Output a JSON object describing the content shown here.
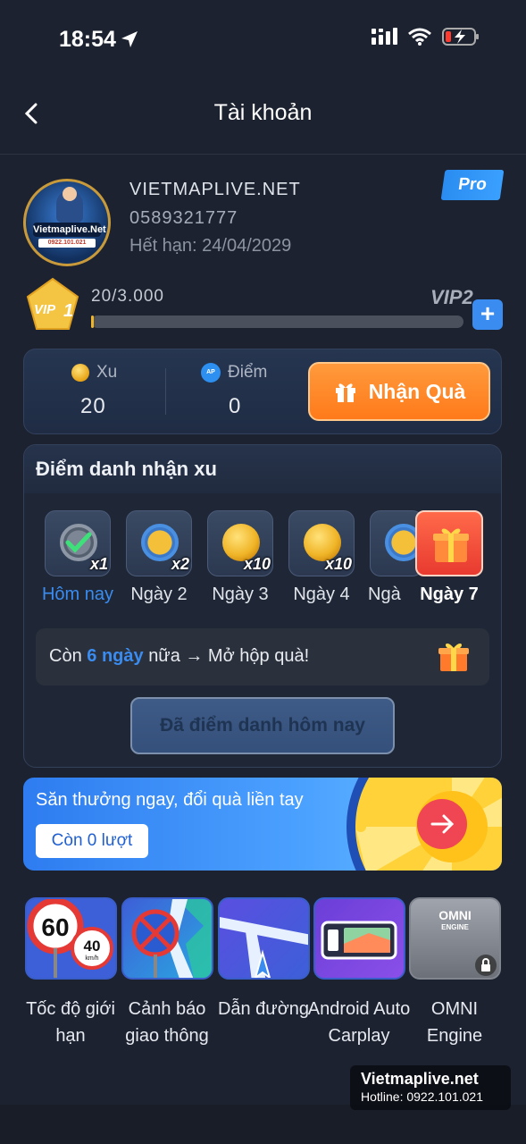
{
  "status_bar": {
    "time": "18:54"
  },
  "nav": {
    "title": "Tài khoản"
  },
  "profile": {
    "name": "VIETMAPLIVE.NET",
    "phone": "0589321777",
    "expiry": "Hết hạn: 24/04/2029",
    "badge": "Pro",
    "avatar_text": "Vietmaplive.Net",
    "avatar_subtext": "0922.101.021"
  },
  "vip": {
    "current_level_text": "VIP",
    "current_level_number": "1",
    "progress_text": "20/3.000",
    "progress_fraction": 0.0067,
    "next_level": "VIP2",
    "plus_label": "+"
  },
  "points": {
    "xu_label": "Xu",
    "xu_value": "20",
    "diem_label": "Điểm",
    "diem_value": "0",
    "ap_icon": "AP",
    "gift_button": "Nhận Quà"
  },
  "checkin": {
    "title": "Điểm danh nhận xu",
    "days": [
      {
        "label": "Hôm nay",
        "mult": "x1"
      },
      {
        "label": "Ngày 2",
        "mult": "x2"
      },
      {
        "label": "Ngày 3",
        "mult": "x10"
      },
      {
        "label": "Ngày 4",
        "mult": "x10"
      },
      {
        "label": "Ngà",
        "mult": ""
      },
      {
        "label": "Ngày 7",
        "mult": ""
      }
    ],
    "remain_prefix": "Còn",
    "remain_days": "6 ngày",
    "remain_suffix": "nữa → Mở hộp quà!",
    "checked_button": "Đã điểm danh hôm nay"
  },
  "lucky": {
    "text": "Săn thưởng ngay, đổi quà liền tay",
    "chip": "Còn 0 lượt"
  },
  "features": [
    {
      "label": "Tốc độ giới hạn",
      "speed_big": "60",
      "speed_small": "40",
      "unit": "km/h"
    },
    {
      "label": "Cảnh báo giao thông"
    },
    {
      "label": "Dẫn đường"
    },
    {
      "label": "Android Auto Carplay"
    },
    {
      "label": "OMNI Engine",
      "title": "OMNI",
      "subtitle": "ENGINE"
    }
  ],
  "watermark": {
    "site": "Vietmaplive.net",
    "hotline": "Hotline: 0922.101.021"
  },
  "colors": {
    "background": "#1c2230",
    "accent": "#3a8cf0",
    "orange": "#ff8a2a",
    "gold": "#f0b428"
  }
}
